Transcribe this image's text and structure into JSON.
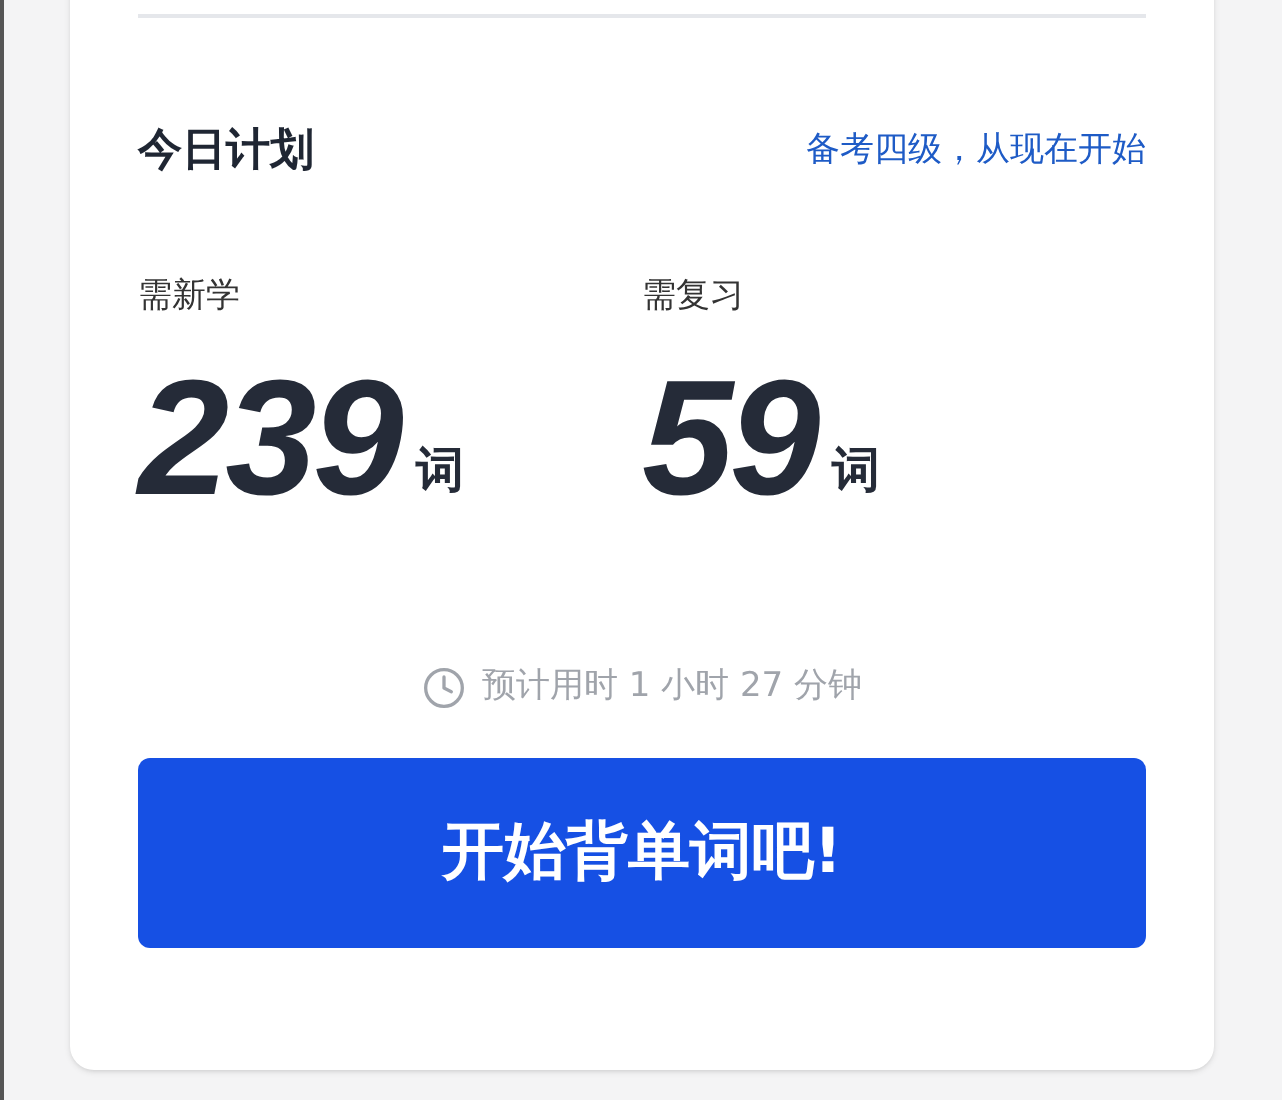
{
  "plan": {
    "title": "今日计划",
    "link": "备考四级，从现在开始"
  },
  "stats": [
    {
      "label": "需新学",
      "value": "239",
      "unit": "词"
    },
    {
      "label": "需复习",
      "value": "59",
      "unit": "词"
    }
  ],
  "estimate": "预计用时 1 小时 27 分钟",
  "start_button": "开始背单词吧!"
}
